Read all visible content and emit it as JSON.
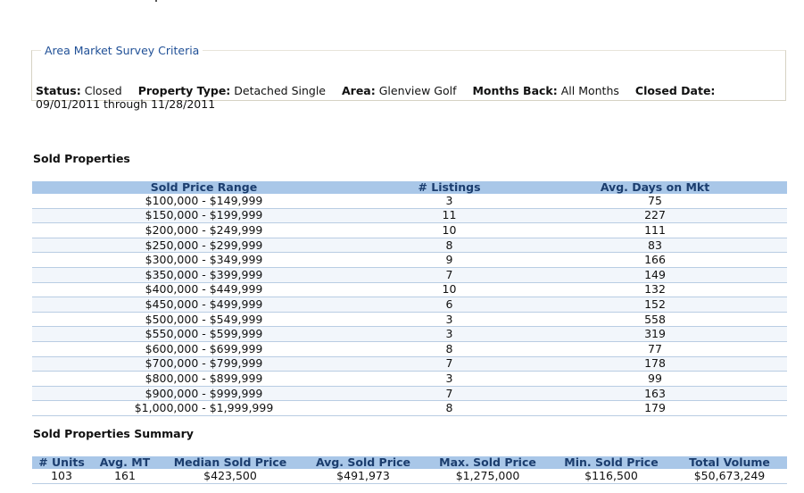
{
  "criteria": {
    "legend": "Area Market Survey Criteria",
    "items": [
      {
        "label": "Status:",
        "value": "Closed"
      },
      {
        "label": "Property Type:",
        "value": "Detached Single"
      },
      {
        "label": "Area:",
        "value": "Glenview Golf"
      },
      {
        "label": "Months Back:",
        "value": "All Months"
      },
      {
        "label": "Closed Date:",
        "value": "09/01/2011 through 11/28/2011"
      }
    ]
  },
  "sold": {
    "title": "Sold Properties",
    "headers": [
      "Sold Price Range",
      "# Listings",
      "Avg. Days on Mkt"
    ],
    "rows": [
      [
        "$100,000 - $149,999",
        "3",
        "75"
      ],
      [
        "$150,000 - $199,999",
        "11",
        "227"
      ],
      [
        "$200,000 - $249,999",
        "10",
        "111"
      ],
      [
        "$250,000 - $299,999",
        "8",
        "83"
      ],
      [
        "$300,000 - $349,999",
        "9",
        "166"
      ],
      [
        "$350,000 - $399,999",
        "7",
        "149"
      ],
      [
        "$400,000 - $449,999",
        "10",
        "132"
      ],
      [
        "$450,000 - $499,999",
        "6",
        "152"
      ],
      [
        "$500,000 - $549,999",
        "3",
        "558"
      ],
      [
        "$550,000 - $599,999",
        "3",
        "319"
      ],
      [
        "$600,000 - $699,999",
        "8",
        "77"
      ],
      [
        "$700,000 - $799,999",
        "7",
        "178"
      ],
      [
        "$800,000 - $899,999",
        "3",
        "99"
      ],
      [
        "$900,000 - $999,999",
        "7",
        "163"
      ],
      [
        "$1,000,000 - $1,999,999",
        "8",
        "179"
      ]
    ]
  },
  "summary": {
    "title": "Sold Properties Summary",
    "headers": [
      "# Units",
      "Avg. MT",
      "Median Sold Price",
      "Avg. Sold Price",
      "Max. Sold Price",
      "Min. Sold Price",
      "Total Volume"
    ],
    "rows": [
      [
        "103",
        "161",
        "$423,500",
        "$491,973",
        "$1,275,000",
        "$116,500",
        "$50,673,249"
      ]
    ]
  }
}
